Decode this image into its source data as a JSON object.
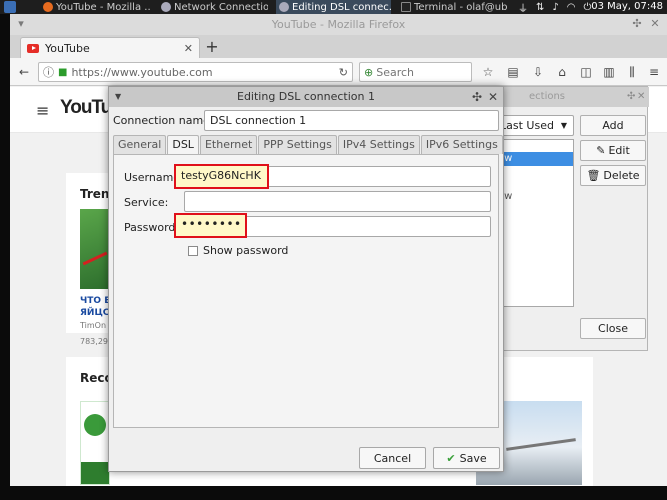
{
  "taskbar": {
    "tasks": [
      {
        "label": "YouTube - Mozilla ..."
      },
      {
        "label": "Network Connectio..."
      },
      {
        "label": "Editing DSL connec..."
      },
      {
        "label": "Terminal - olaf@ub..."
      }
    ],
    "clock": "03 May, 07:48"
  },
  "firefox": {
    "window_title": "YouTube - Mozilla Firefox",
    "tab_label": "YouTube",
    "url": "https://www.youtube.com",
    "search_placeholder": "Search"
  },
  "youtube": {
    "logo": "YouTube",
    "trending_heading": "Trend",
    "video_title": "ЧТО Е\nЯЙЦС",
    "channel": "TimOn",
    "views": "783,29",
    "recommended_heading": "Reco"
  },
  "netwin": {
    "title": "ections",
    "sort_value": "Last Used",
    "row1": "ow",
    "row2": "ow",
    "add": "Add",
    "edit": "Edit",
    "delete": "Delete",
    "close": "Close"
  },
  "dialog": {
    "title": "Editing DSL connection 1",
    "connection_name_label": "Connection name:",
    "connection_name_value": "DSL connection 1",
    "tabs": [
      "General",
      "DSL",
      "Ethernet",
      "PPP Settings",
      "IPv4 Settings",
      "IPv6 Settings"
    ],
    "username_label": "Username:",
    "username_value": "testyG86NcHK",
    "service_label": "Service:",
    "service_value": "",
    "password_label": "Password:",
    "password_value": "••••••••",
    "show_password": "Show password",
    "cancel": "Cancel",
    "save": "Save"
  },
  "colors": {
    "highlight": "#e0101a",
    "selection": "#3d8ee3",
    "youtube_red": "#e52d27"
  }
}
